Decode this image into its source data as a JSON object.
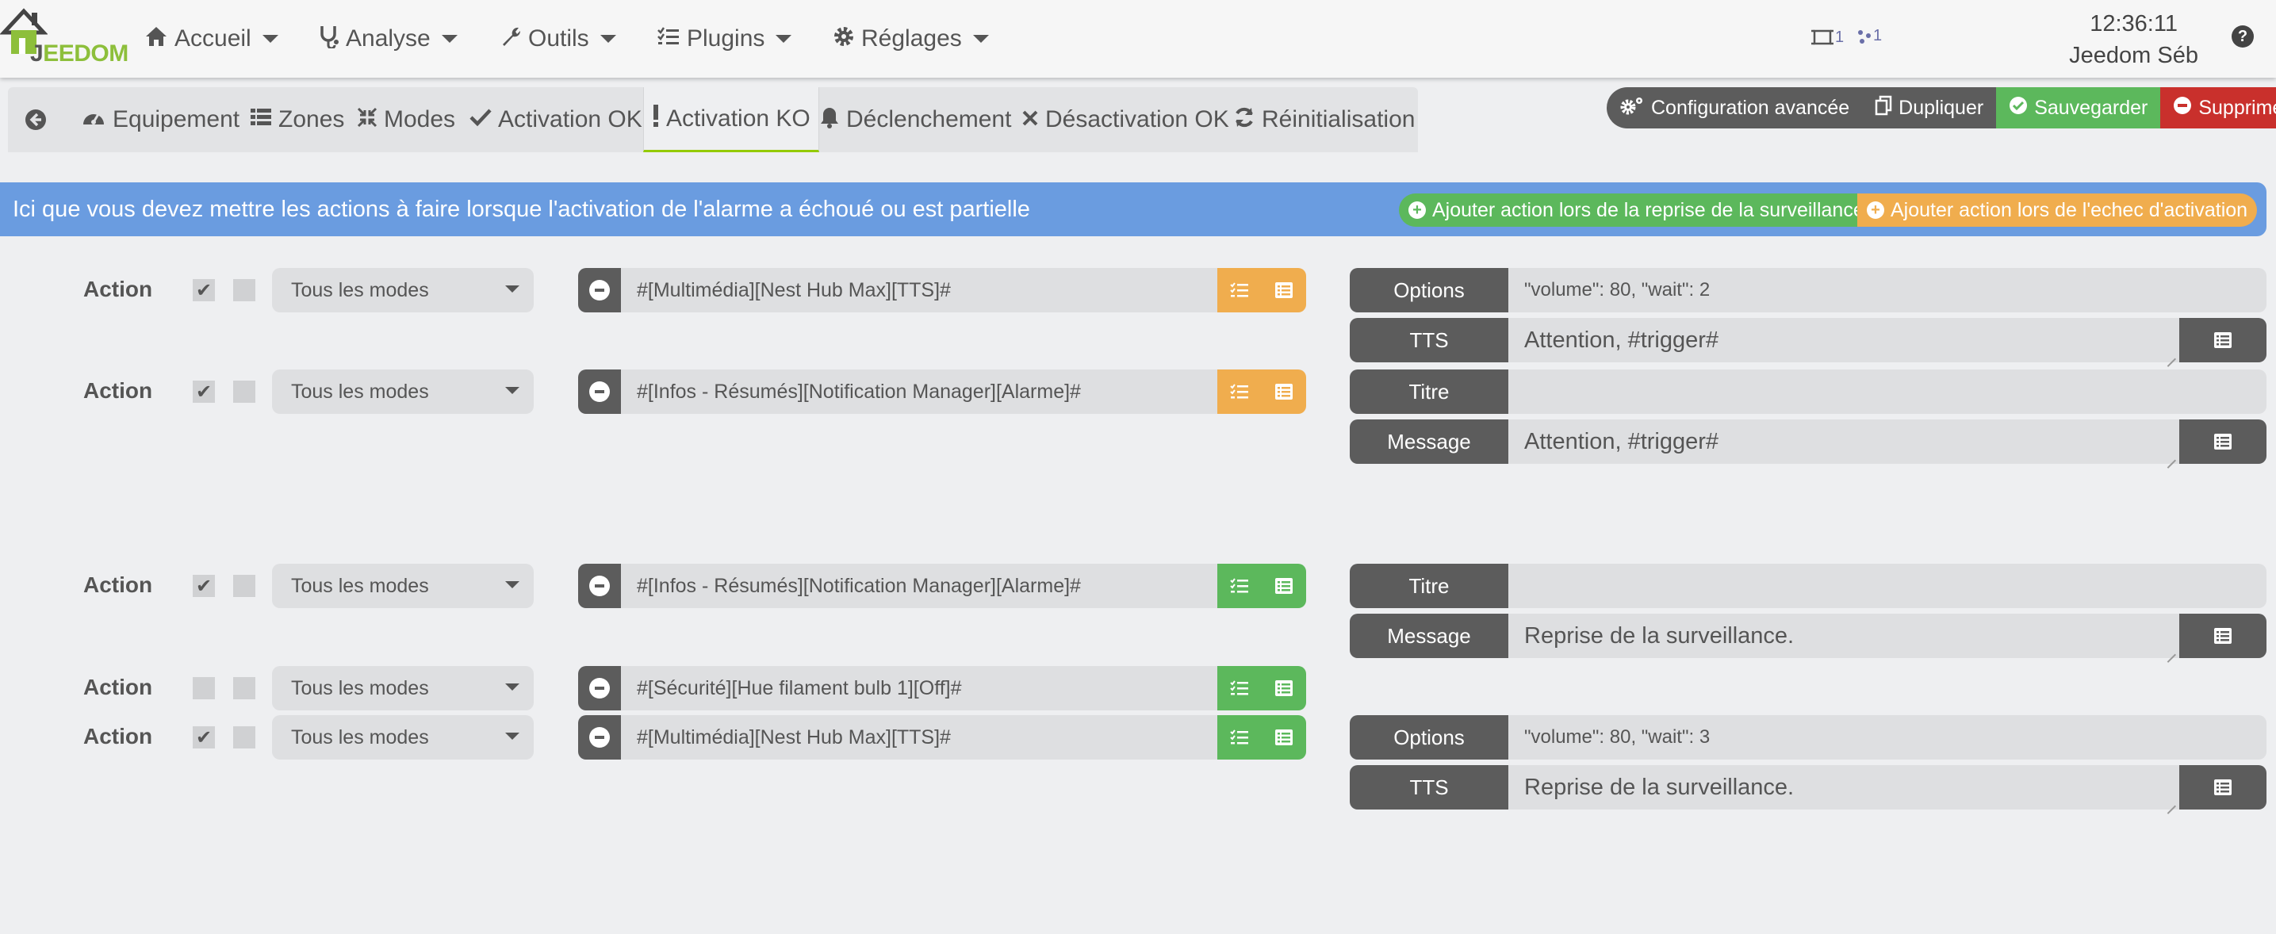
{
  "navbar": {
    "logo_text_j": "J",
    "logo_text_rest": "EEDOM",
    "menu": [
      {
        "label": "Accueil",
        "icon": "home-icon"
      },
      {
        "label": "Analyse",
        "icon": "stethoscope-icon"
      },
      {
        "label": "Outils",
        "icon": "wrench-icon"
      },
      {
        "label": "Plugins",
        "icon": "tasks-icon"
      },
      {
        "label": "Réglages",
        "icon": "gear-icon"
      }
    ],
    "stat1": "1",
    "stat2": "1",
    "time": "12:36:11",
    "user": "Jeedom Séb",
    "help": "?"
  },
  "tabs": [
    {
      "label": "",
      "icon": "back-arrow-icon"
    },
    {
      "label": "Equipement",
      "icon": "tachometer-icon"
    },
    {
      "label": "Zones",
      "icon": "list-icon"
    },
    {
      "label": "Modes",
      "icon": "compress-icon"
    },
    {
      "label": "Activation OK",
      "icon": "check-icon"
    },
    {
      "label": "Activation KO",
      "icon": "exclamation-icon"
    },
    {
      "label": "Déclenchement",
      "icon": "bell-icon"
    },
    {
      "label": "Désactivation OK",
      "icon": "times-icon"
    },
    {
      "label": "Réinitialisation",
      "icon": "refresh-icon"
    }
  ],
  "actions_bar": {
    "config": "Configuration avancée",
    "duplicate": "Dupliquer",
    "save": "Sauvegarder",
    "delete": "Supprimer"
  },
  "banner": {
    "text": "Ici que vous devez mettre les actions à faire lorsque l'activation de l'alarme a échoué ou est partielle",
    "add_resume": "Ajouter action lors de la reprise de la surveillance",
    "add_fail": "Ajouter action lors de l'echec d'activation"
  },
  "colors": {
    "accent": "#94ca02",
    "orange": "#f0ad4e",
    "green": "#5cb85c",
    "red": "#c9302c",
    "banner": "#6a9ce0",
    "dark": "#5c5c5c"
  },
  "rows": [
    {
      "label": "Action",
      "checked": true,
      "mode": "Tous les modes",
      "cmd": "#[Multimédia][Nest Hub Max][TTS]#",
      "color": "orange"
    },
    {
      "label": "Action",
      "checked": true,
      "mode": "Tous les modes",
      "cmd": "#[Infos - Résumés][Notification Manager][Alarme]#",
      "color": "orange"
    },
    {
      "label": "Action",
      "checked": true,
      "mode": "Tous les modes",
      "cmd": "#[Infos - Résumés][Notification Manager][Alarme]#",
      "color": "green"
    },
    {
      "label": "Action",
      "checked": false,
      "mode": "Tous les modes",
      "cmd": "#[Sécurité][Hue filament bulb 1][Off]#",
      "color": "green"
    },
    {
      "label": "Action",
      "checked": true,
      "mode": "Tous les modes",
      "cmd": "#[Multimédia][Nest Hub Max][TTS]#",
      "color": "green"
    }
  ],
  "options": [
    {
      "label": "Options",
      "value": "\"volume\": 80, \"wait\": 2"
    },
    {
      "label": "TTS",
      "value": "Attention, #trigger#"
    },
    {
      "label": "Titre",
      "value": ""
    },
    {
      "label": "Message",
      "value": "Attention, #trigger#"
    },
    {
      "label": "Titre",
      "value": ""
    },
    {
      "label": "Message",
      "value": "Reprise de la surveillance."
    },
    {
      "label": "Options",
      "value": "\"volume\": 80, \"wait\": 3"
    },
    {
      "label": "TTS",
      "value": "Reprise de la surveillance."
    }
  ]
}
